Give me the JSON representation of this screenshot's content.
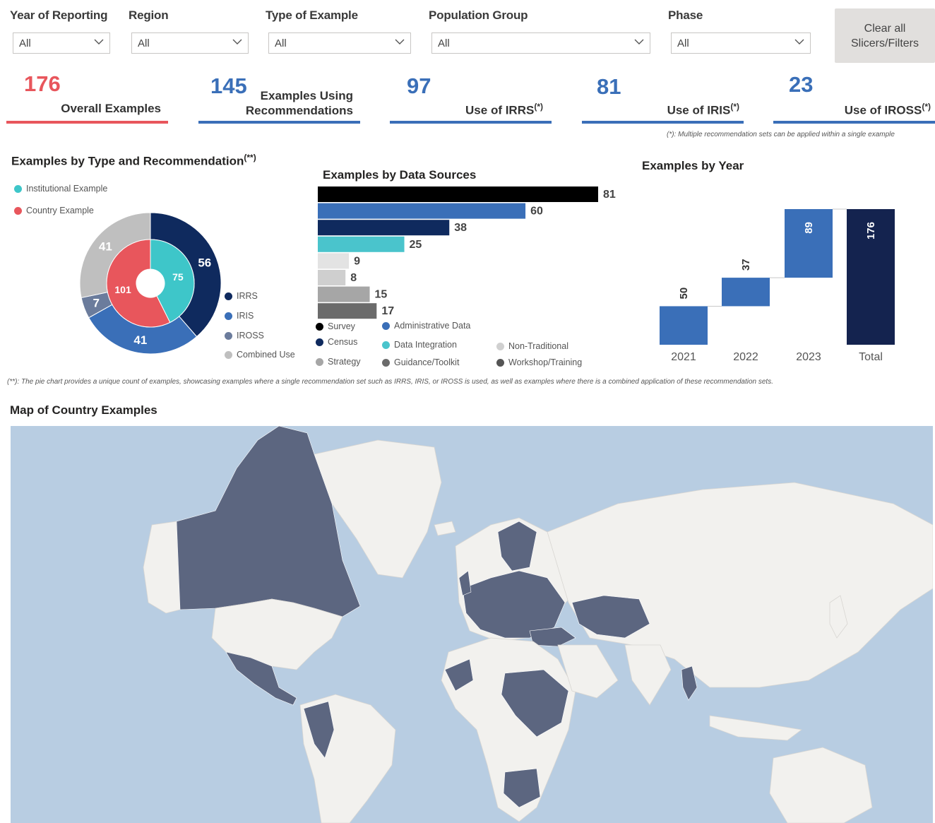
{
  "slicers": [
    {
      "title": "Year of Reporting",
      "value": "All"
    },
    {
      "title": "Region",
      "value": "All"
    },
    {
      "title": "Type of Example",
      "value": "All"
    },
    {
      "title": "Population Group",
      "value": "All"
    },
    {
      "title": "Phase",
      "value": "All"
    }
  ],
  "clear_button": {
    "line1": "Clear all",
    "line2": "Slicers/Filters"
  },
  "kpis": [
    {
      "value": "176",
      "label1": "Overall Examples",
      "label2": "",
      "sup": "",
      "color": "#e8565c"
    },
    {
      "value": "145",
      "label1": "Examples Using",
      "label2": "Recommendations",
      "sup": "",
      "color": "#3a6fb8"
    },
    {
      "value": "97",
      "label1": "Use of IRRS",
      "label2": "",
      "sup": "(*)",
      "color": "#3a6fb8"
    },
    {
      "value": "81",
      "label1": "Use of IRIS",
      "label2": "",
      "sup": "(*)",
      "color": "#3a6fb8"
    },
    {
      "value": "23",
      "label1": "Use of IROSS",
      "label2": "",
      "sup": "(*)",
      "color": "#3a6fb8"
    }
  ],
  "kpi_footnote": "(*): Multiple recommendation sets can be applied within a single example",
  "donut": {
    "title": "Examples by Type and Recommendation",
    "title_sup": "(**)",
    "type_legend": [
      {
        "label": "Institutional Example",
        "color": "#3ec6c9"
      },
      {
        "label": "Country Example",
        "color": "#e8565c"
      }
    ],
    "rec_legend": [
      {
        "label": "IRRS",
        "color": "#0f2a5e"
      },
      {
        "label": "IRIS",
        "color": "#3a6fb8"
      },
      {
        "label": "IROSS",
        "color": "#6b7c9c"
      },
      {
        "label": "Combined Use",
        "color": "#bfbfbf"
      }
    ]
  },
  "chart_data": [
    {
      "type": "pie",
      "title": "Examples by Type and Recommendation",
      "rings": [
        {
          "name": "Type",
          "slices": [
            {
              "label": "Institutional Example",
              "value": 75,
              "color": "#3ec6c9"
            },
            {
              "label": "Country Example",
              "value": 101,
              "color": "#e8565c"
            }
          ]
        },
        {
          "name": "Recommendation",
          "slices": [
            {
              "label": "IRRS",
              "value": 56,
              "color": "#0f2a5e"
            },
            {
              "label": "IRIS",
              "value": 41,
              "color": "#3a6fb8"
            },
            {
              "label": "IROSS",
              "value": 7,
              "color": "#6b7c9c"
            },
            {
              "label": "Combined Use",
              "value": 41,
              "color": "#bfbfbf"
            }
          ]
        }
      ]
    },
    {
      "type": "bar",
      "title": "Examples by Data Sources",
      "orientation": "horizontal",
      "categories": [
        "Survey",
        "Administrative Data",
        "Census",
        "Data Integration",
        "Non-Traditional",
        "Strategy",
        "Guidance/Toolkit",
        "Workshop/Training"
      ],
      "values": [
        81,
        60,
        38,
        25,
        9,
        8,
        15,
        17
      ],
      "colors": [
        "#000000",
        "#3a6fb8",
        "#0f2a5e",
        "#4ac4cc",
        "#e3e3e3",
        "#cfcfcf",
        "#a6a6a6",
        "#6b6b6b"
      ],
      "legend_placement": "bottom"
    },
    {
      "type": "bar",
      "subtype": "waterfall",
      "title": "Examples by Year",
      "categories": [
        "2021",
        "2022",
        "2023",
        "Total"
      ],
      "values": [
        50,
        37,
        89,
        176
      ],
      "colors": [
        "#3a6fb8",
        "#3a6fb8",
        "#3a6fb8",
        "#14234f"
      ]
    }
  ],
  "bars_panel": {
    "title": "Examples by Data Sources",
    "legend": [
      {
        "label": "Survey",
        "color": "#000000"
      },
      {
        "label": "Census",
        "color": "#0f2a5e"
      },
      {
        "label": "Strategy",
        "color": "#a6a6a6"
      },
      {
        "label": "Administrative Data",
        "color": "#3a6fb8"
      },
      {
        "label": "Data Integration",
        "color": "#4ac4cc"
      },
      {
        "label": "Guidance/Toolkit",
        "color": "#6b6b6b"
      },
      {
        "label": "Non-Traditional",
        "color": "#d0d0d0"
      },
      {
        "label": "Workshop/Training",
        "color": "#555555"
      }
    ]
  },
  "year_panel": {
    "title": "Examples by Year"
  },
  "pie_footnote": "(**): The pie chart provides a unique count of examples, showcasing examples where a single recommendation set such as IRRS, IRIS, or IROSS is used, as well as examples where there is a combined application of these recommendation sets.",
  "map": {
    "title": "Map of Country Examples",
    "ocean_color": "#b8cde2",
    "land_color": "#f2f1ee",
    "highlight_color": "#5c6680"
  }
}
